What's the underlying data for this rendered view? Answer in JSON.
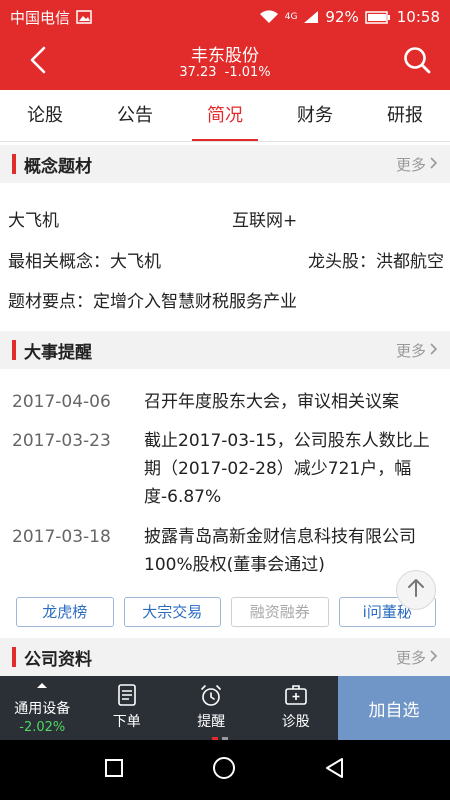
{
  "status_bar": {
    "carrier": "中国电信",
    "network": "4G",
    "battery": "92%",
    "time": "10:58"
  },
  "header": {
    "title": "丰东股份",
    "price": "37.23",
    "change": "-1.01%"
  },
  "tabs": [
    {
      "label": "论股",
      "active": false
    },
    {
      "label": "公告",
      "active": false
    },
    {
      "label": "简况",
      "active": true
    },
    {
      "label": "财务",
      "active": false
    },
    {
      "label": "研报",
      "active": false
    }
  ],
  "concept": {
    "title": "概念题材",
    "more": "更多",
    "tag1": "大飞机",
    "tag2": "互联网+",
    "related_label": "最相关概念：大飞机",
    "leader_label": "龙头股：洪都航空",
    "key_points": "题材要点：定增介入智慧财税服务产业"
  },
  "events": {
    "title": "大事提醒",
    "more": "更多",
    "items": [
      {
        "date": "2017-04-06",
        "text": "召开年度股东大会，审议相关议案"
      },
      {
        "date": "2017-03-23",
        "text": "截止2017-03-15，公司股东人数比上期（2017-02-28）减少721户，幅度-6.87%"
      },
      {
        "date": "2017-03-18",
        "text": "披露青岛高新金财信息科技有限公司100%股权(董事会通过)"
      }
    ]
  },
  "chips": [
    {
      "label": "龙虎榜",
      "disabled": false
    },
    {
      "label": "大宗交易",
      "disabled": false
    },
    {
      "label": "融资融券",
      "disabled": true
    },
    {
      "label": "i问董秘",
      "disabled": false
    }
  ],
  "company": {
    "title": "公司资料",
    "more": "更多"
  },
  "toolbar": {
    "sector_name": "通用设备",
    "sector_change": "-2.02%",
    "order": "下单",
    "alert": "提醒",
    "diagnose": "诊股",
    "add_favorite": "加自选"
  },
  "colors": {
    "brand_red": "#e22b2b",
    "toolbar_bg": "#2b2f36",
    "add_fav_bg": "#6f96c6",
    "positive_green": "#4cd964",
    "link_blue": "#2b6cc1"
  }
}
